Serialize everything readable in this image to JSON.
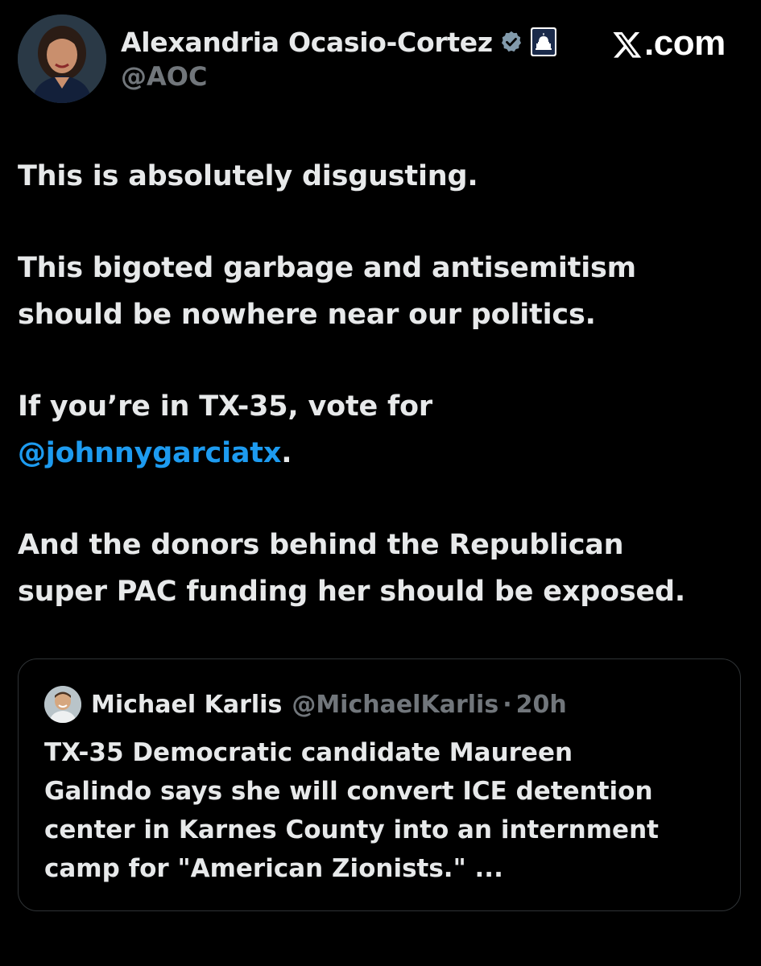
{
  "author": {
    "display_name": "Alexandria Ocasio-Cortez",
    "handle": "@AOC",
    "avatar_icon": "profile-photo-avatar",
    "verified_icon": "verified-badge-icon",
    "affiliation_icon": "capitol-building-icon"
  },
  "brand": {
    "label": ".com",
    "icon": "x-logo-icon"
  },
  "tweet": {
    "lines": [
      "This is absolutely disgusting.",
      "This bigoted garbage and antisemitism",
      "should be nowhere near our politics.",
      "If you’re in TX-35, vote for",
      "And the donors behind the Republican",
      "super PAC funding her should be exposed."
    ],
    "mention": "@johnnygarciatx",
    "mention_suffix": "."
  },
  "quote": {
    "display_name": "Michael Karlis",
    "handle": "@MichaelKarlis",
    "separator": "·",
    "time": "20h",
    "avatar_icon": "profile-photo-avatar",
    "lines": [
      "TX-35 Democratic candidate Maureen",
      "Galindo says she will convert ICE detention",
      "center in Karnes County into an internment",
      "camp for \"American Zionists.\" ..."
    ]
  },
  "colors": {
    "background": "#000000",
    "text": "#e7e9ea",
    "secondary_text": "#71767b",
    "link": "#1d9bf0",
    "border": "#2f3336",
    "verified_badge": "#829aab"
  }
}
